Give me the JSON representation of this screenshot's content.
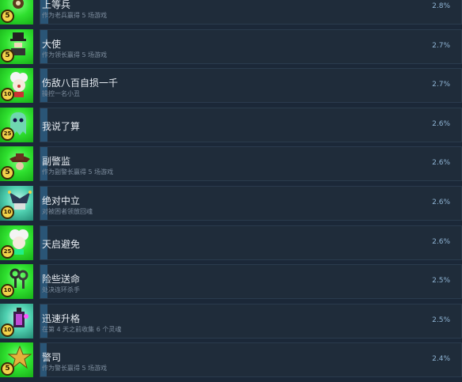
{
  "achievements": [
    {
      "name": "上等兵",
      "desc": "作为老兵赢得 5 场游戏",
      "pct": "2.8%",
      "badge": "5",
      "fill": 0.028,
      "icon": "soldier-icon",
      "color": "green"
    },
    {
      "name": "大使",
      "desc": "作为领长赢得 5 场游戏",
      "pct": "2.7%",
      "badge": "5",
      "fill": 0.027,
      "icon": "ambassador-icon",
      "color": "green"
    },
    {
      "name": "伤敌八百自损一千",
      "desc": "操控一名小丑",
      "pct": "2.7%",
      "badge": "10",
      "fill": 0.027,
      "icon": "clown-icon",
      "color": "green"
    },
    {
      "name": "我说了算",
      "desc": "",
      "pct": "2.6%",
      "badge": "25",
      "fill": 0.026,
      "icon": "ghost-icon",
      "color": "green"
    },
    {
      "name": "副警监",
      "desc": "作为副警长赢得 5 场游戏",
      "pct": "2.6%",
      "badge": "5",
      "fill": 0.026,
      "icon": "deputy-hat-icon",
      "color": "green"
    },
    {
      "name": "绝对中立",
      "desc": "对被困者领放回魂",
      "pct": "2.6%",
      "badge": "10",
      "fill": 0.026,
      "icon": "jester-hat-icon",
      "color": "teal"
    },
    {
      "name": "天启避免",
      "desc": "",
      "pct": "2.6%",
      "badge": "25",
      "fill": 0.026,
      "icon": "white-hair-icon",
      "color": "green"
    },
    {
      "name": "险些送命",
      "desc": "处决连环杀手",
      "pct": "2.5%",
      "badge": "10",
      "fill": 0.025,
      "icon": "keys-icon",
      "color": "green"
    },
    {
      "name": "迅速升格",
      "desc": "在第 4 天之前收集 6 个灵魂",
      "pct": "2.5%",
      "badge": "10",
      "fill": 0.025,
      "icon": "lantern-icon",
      "color": "teal"
    },
    {
      "name": "警司",
      "desc": "作为警长赢得 5 场游戏",
      "pct": "2.4%",
      "badge": "5",
      "fill": 0.024,
      "icon": "star-badge-icon",
      "color": "green"
    }
  ]
}
